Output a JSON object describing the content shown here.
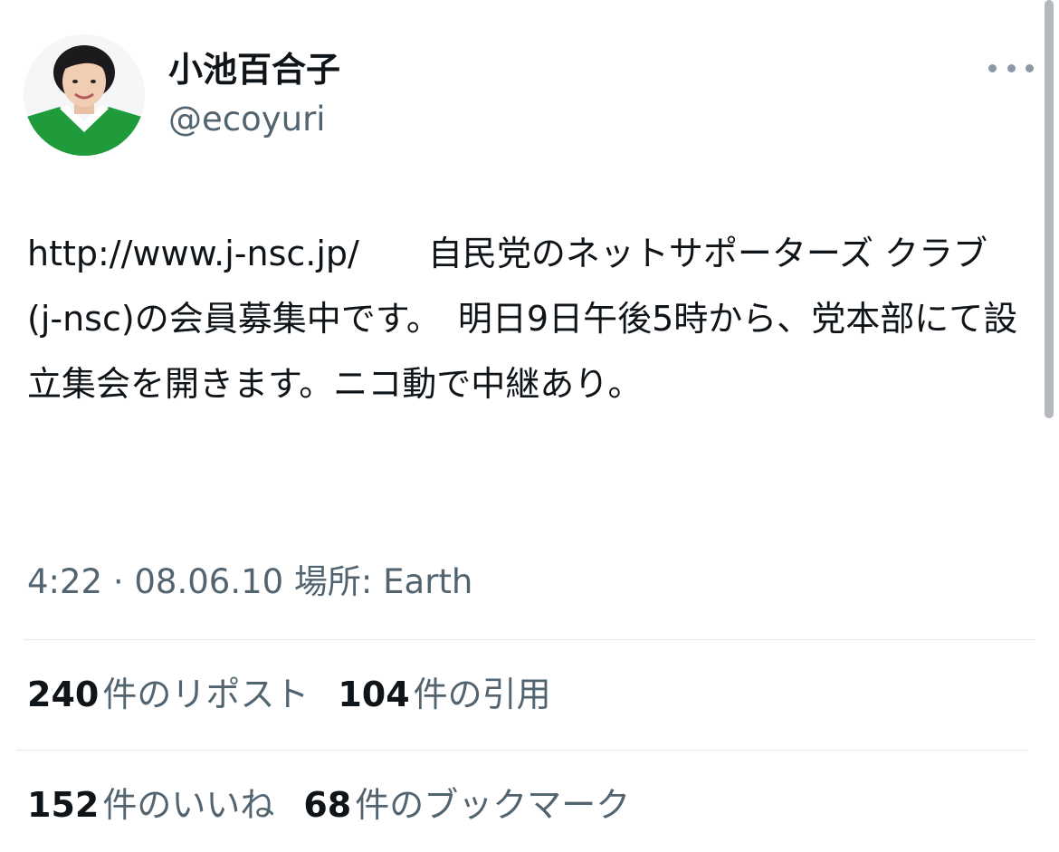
{
  "author": {
    "display_name": "小池百合子",
    "handle": "@ecoyuri",
    "avatar_icon": "profile-photo"
  },
  "more_icon": "more-horizontal-icon",
  "tweet": {
    "link": "http://www.j-nsc.jp/",
    "text": "自民党のネットサポーターズ クラブ(j-nsc)の会員募集中です。　明日9日午後5時から、党本部にて設立集会を開きます。ニコ動で中継あり。"
  },
  "meta": {
    "time": "4:22",
    "separator": "·",
    "date": "08.06.10",
    "location_label": "場所: Earth"
  },
  "stats": {
    "reposts": {
      "count": "240",
      "label": "件のリポスト"
    },
    "quotes": {
      "count": "104",
      "label": "件の引用"
    },
    "likes": {
      "count": "152",
      "label": "件のいいね"
    },
    "bookmarks": {
      "count": "68",
      "label": "件のブックマーク"
    }
  },
  "colors": {
    "text": "#0f1419",
    "secondary": "#536471",
    "divider": "#e6e9ec",
    "avatar_green": "#1f9b3c"
  }
}
